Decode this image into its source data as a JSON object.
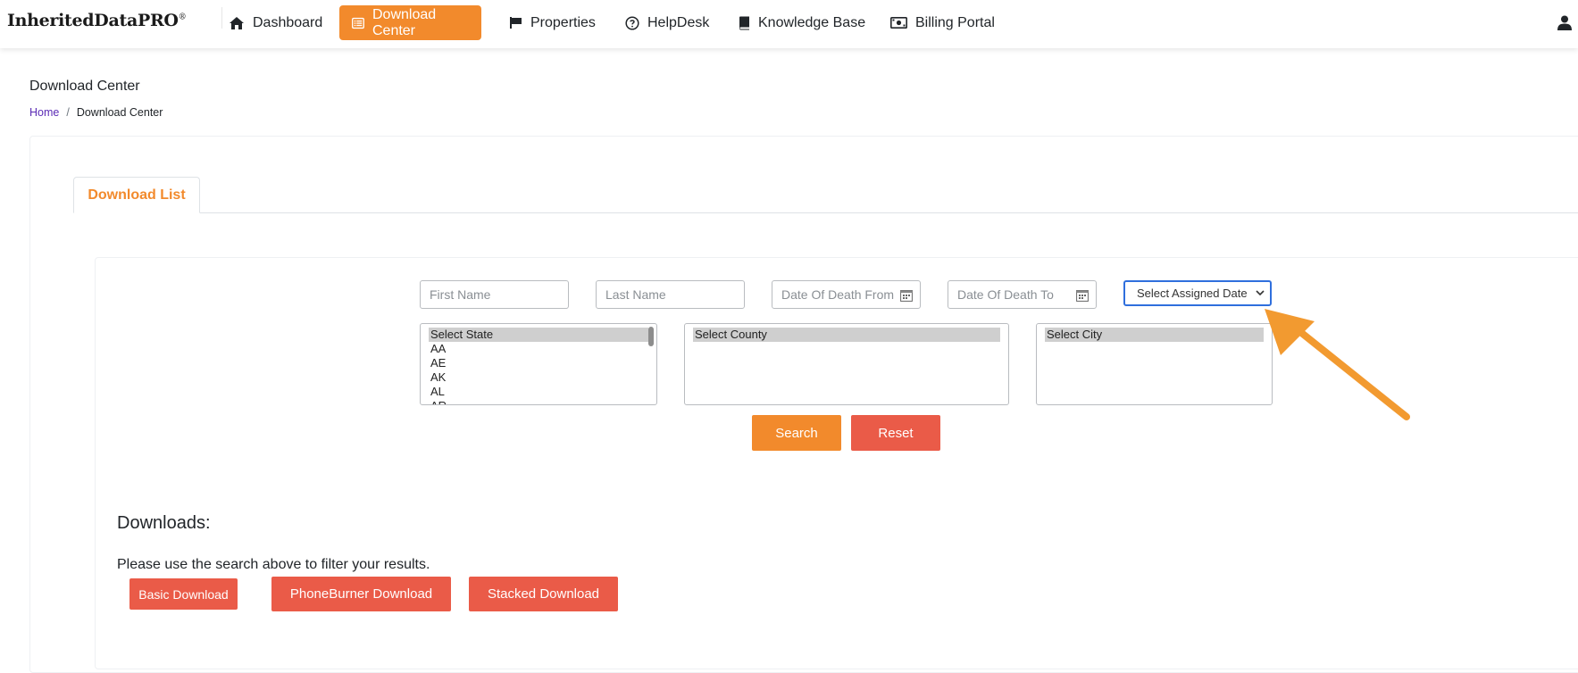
{
  "brand": {
    "name": "InheritedDataPRO",
    "mark": "®"
  },
  "nav": {
    "items": [
      {
        "label": "Dashboard",
        "icon": "home-icon",
        "active": false
      },
      {
        "label": "Download Center",
        "icon": "list-icon",
        "active": true
      },
      {
        "label": "Properties",
        "icon": "flag-icon",
        "active": false
      },
      {
        "label": "HelpDesk",
        "icon": "question-circle-icon",
        "active": false
      },
      {
        "label": "Knowledge Base",
        "icon": "book-icon",
        "active": false
      },
      {
        "label": "Billing Portal",
        "icon": "money-bill-icon",
        "active": false
      }
    ],
    "user_icon": "user-icon"
  },
  "page": {
    "title": "Download Center",
    "breadcrumb": {
      "home": "Home",
      "separator": "/",
      "current": "Download Center"
    }
  },
  "tabs": {
    "active_label": "Download List"
  },
  "filters": {
    "first_name_placeholder": "First Name",
    "last_name_placeholder": "Last Name",
    "dod_from_placeholder": "Date Of Death From",
    "dod_to_placeholder": "Date Of Death To",
    "assigned_date_selected": "Select Assigned Date",
    "state": {
      "options": [
        "Select State",
        "AA",
        "AE",
        "AK",
        "AL",
        "AR"
      ]
    },
    "county": {
      "options": [
        "Select County"
      ]
    },
    "city": {
      "options": [
        "Select City"
      ]
    },
    "search_label": "Search",
    "reset_label": "Reset"
  },
  "downloads": {
    "title": "Downloads:",
    "message": "Please use the search above to filter your results.",
    "basic_label": "Basic Download",
    "phoneburner_label": "PhoneBurner Download",
    "stacked_label": "Stacked Download"
  },
  "colors": {
    "accent_orange": "#f28a2c",
    "button_red": "#ea5b48",
    "focus_blue": "#2f6fdd",
    "annotation_arrow": "#f29a30"
  }
}
